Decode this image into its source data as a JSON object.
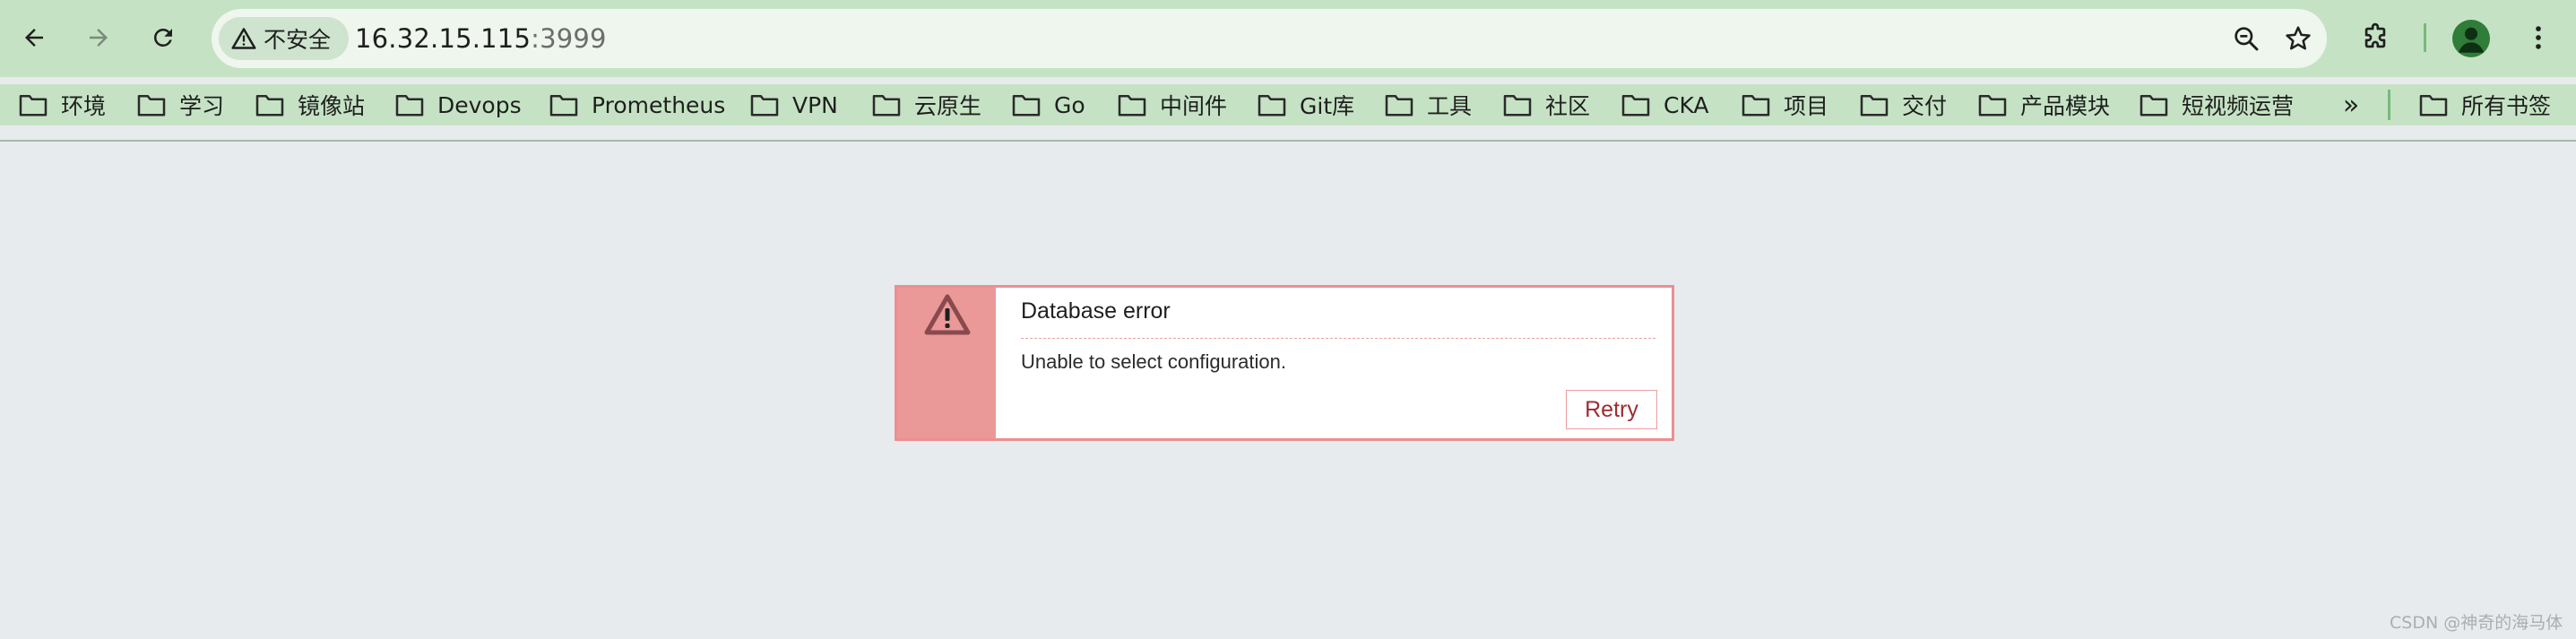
{
  "browser": {
    "security_label": "不安全",
    "url_host": "16.32.15.115",
    "url_port": ":3999"
  },
  "bookmarks": {
    "items": [
      {
        "label": "环境"
      },
      {
        "label": "学习"
      },
      {
        "label": "镜像站"
      },
      {
        "label": "Devops"
      },
      {
        "label": "Prometheus"
      },
      {
        "label": "VPN"
      },
      {
        "label": "云原生"
      },
      {
        "label": "Go"
      },
      {
        "label": "中间件"
      },
      {
        "label": "Git库"
      },
      {
        "label": "工具"
      },
      {
        "label": "社区"
      },
      {
        "label": "CKA"
      },
      {
        "label": "项目"
      },
      {
        "label": "交付"
      },
      {
        "label": "产品模块"
      },
      {
        "label": "短视频运营"
      }
    ],
    "overflow_label": "»",
    "all_bookmarks_label": "所有书签"
  },
  "alert": {
    "title": "Database error",
    "message": "Unable to select configuration.",
    "retry_label": "Retry"
  },
  "watermark": "CSDN @神奇的海马体",
  "colors": {
    "chrome": "#c5e3c4",
    "alert_accent": "#eb9899",
    "alert_border": "#eb8f90",
    "retry_text": "#9c2d31"
  }
}
